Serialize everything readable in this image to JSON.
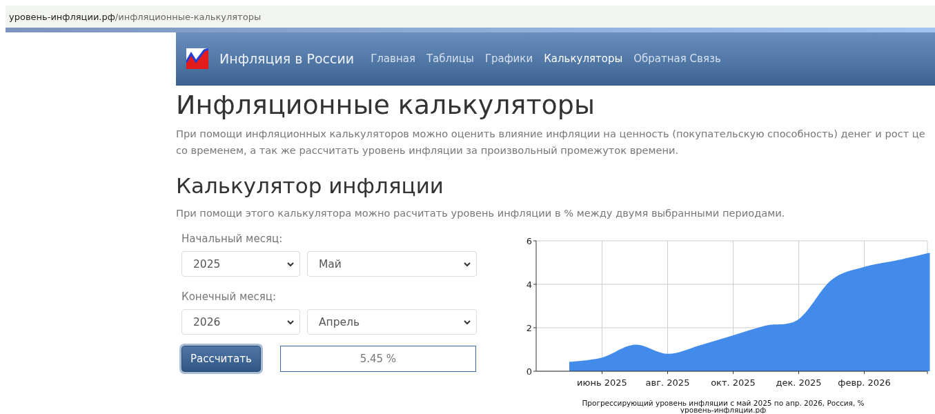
{
  "address_bar": {
    "domain": "уровень-инфляции.рф",
    "path": "/инфляционные-калькуляторы"
  },
  "navbar": {
    "brand": "Инфляция в России",
    "items": [
      {
        "label": "Главная",
        "selected": false
      },
      {
        "label": "Таблицы",
        "selected": false
      },
      {
        "label": "Графики",
        "selected": false
      },
      {
        "label": "Калькуляторы",
        "selected": true
      },
      {
        "label": "Обратная Связь",
        "selected": false
      }
    ]
  },
  "page": {
    "title": "Инфляционные калькуляторы",
    "intro": [
      "При помощи инфляционных калькуляторов можно оценить влияние инфляции на ценность (покупательскую способность) денег и рост це",
      "со временем, а так же рассчитать уровень инфляции за произвольный промежуток времени."
    ]
  },
  "calculator": {
    "title": "Калькулятор инфляции",
    "description": "При помощи этого калькулятора можно расчитать уровень инфляции в % между двумя выбранными периодами.",
    "start": {
      "label": "Начальный месяц:",
      "year": "2025",
      "month": "Май"
    },
    "end": {
      "label": "Конечный месяц:",
      "year": "2026",
      "month": "Апрель"
    },
    "button": "Рассчитать",
    "result": "5.45 %",
    "chart_source": "уровень-инфляции.рф",
    "chart_data": {
      "type": "area",
      "title": "Прогрессирующий уровень инфляции с май 2025 по апр. 2026, Россия, %",
      "grid": true,
      "categories": [
        null,
        "июнь 2025",
        null,
        "авг. 2025",
        null,
        "окт. 2025",
        null,
        "дек. 2025",
        null,
        "февр. 2026",
        null,
        null
      ],
      "series": [
        {
          "color": "#428bea",
          "values": [
            0.43,
            0.63,
            1.22,
            0.8,
            1.2,
            1.65,
            2.1,
            2.4,
            4.2,
            4.8,
            5.1,
            5.45
          ]
        }
      ],
      "ylim": [
        0,
        6
      ],
      "yticks": [
        0,
        2,
        4,
        6
      ]
    }
  }
}
